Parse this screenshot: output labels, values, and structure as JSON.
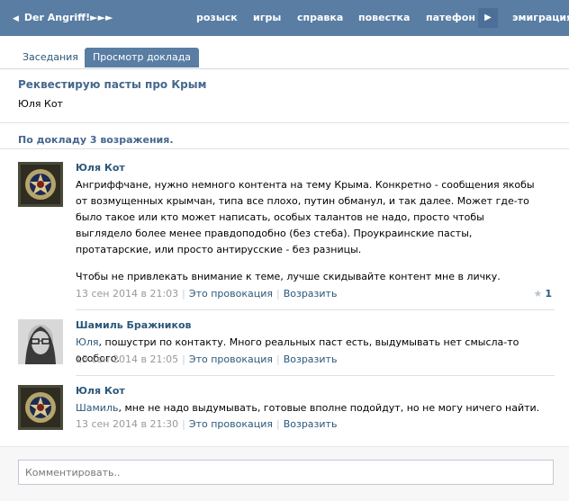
{
  "topbar": {
    "back_label": "Der Angriff!►►►",
    "nav": [
      "розыск",
      "игры",
      "справка",
      "повестка",
      "патефон",
      "эмиграция"
    ],
    "more_icon": "chevron-right-icon"
  },
  "tabs": [
    {
      "label": "Заседания",
      "active": false
    },
    {
      "label": "Просмотр доклада",
      "active": true
    }
  ],
  "doc": {
    "title": "Реквестирую пасты про Крым",
    "author": "Юля Кот"
  },
  "objections_count": "По докладу 3 возражения.",
  "posts": [
    {
      "author": "Юля Кот",
      "text_1": "Ангриффчане, нужно немного контента на тему Крыма. Конкретно - сообщения якобы от возмущенных крымчан, типа все плохо, путин обманул, и так далее. Может где-то было такое или кто может написать, особых талантов не надо, просто чтобы выглядело более менее правдоподобно (без стеба). Проукраинские пасты, протатарские, или просто антирусские - без разницы.",
      "text_2": "Чтобы не привлекать внимание к теме, лучше скидывайте контент мне в личку.",
      "date": "13 сен 2014 в 21:03",
      "action_1": "Это провокация",
      "action_2": "Возразить",
      "likes": "1"
    },
    {
      "author": "Шамиль Бражников",
      "mention": "Юля",
      "text": ", пошустри по контакту. Много реальных паст есть, выдумывать нет смысла-то особого.",
      "date": "13 сен 2014 в 21:05",
      "action_1": "Это провокация",
      "action_2": "Возразить"
    },
    {
      "author": "Юля Кот",
      "mention": "Шамиль",
      "text": ", мне не надо выдумывать, готовые вполне подойдут, но не могу ничего найти.",
      "date": "13 сен 2014 в 21:30",
      "action_1": "Это провокация",
      "action_2": "Возразить"
    }
  ],
  "comment": {
    "placeholder": "Комментировать.."
  },
  "colors": {
    "header": "#597da3",
    "link": "#2B587A",
    "title": "#45688E"
  }
}
